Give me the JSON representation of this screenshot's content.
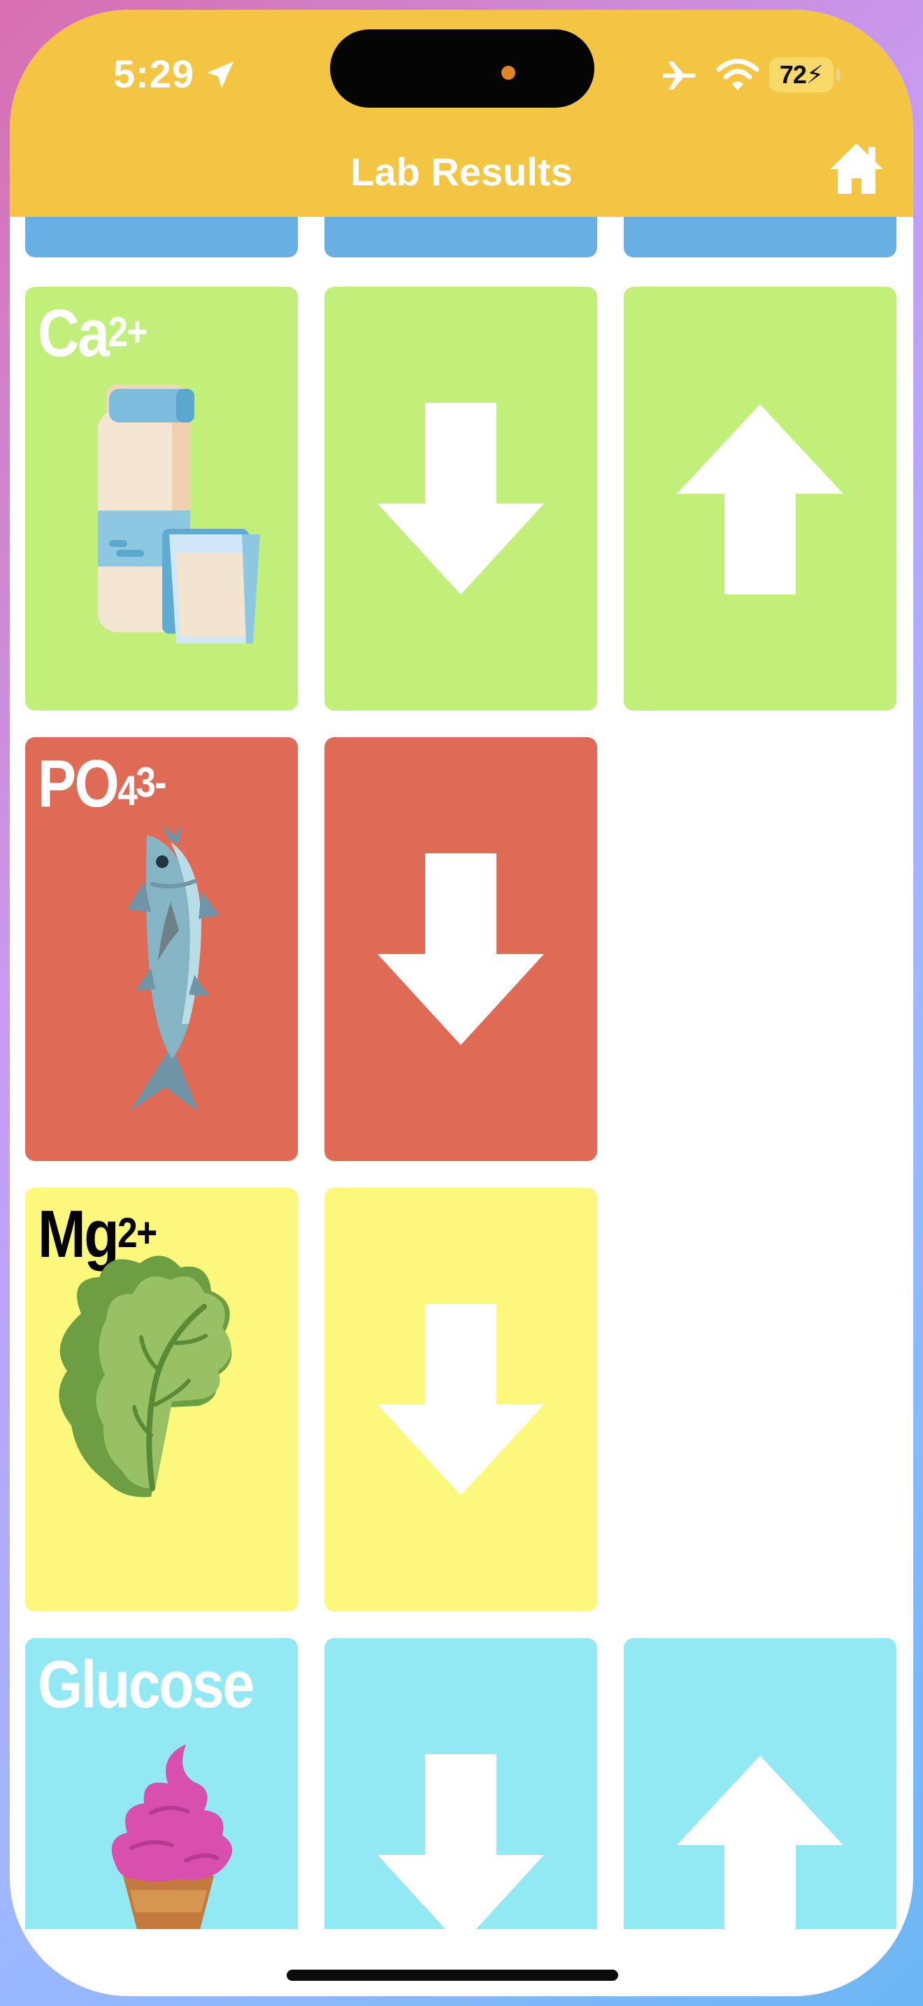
{
  "status_bar": {
    "time": "5:29",
    "battery": "72",
    "icons": [
      "location-arrow-icon",
      "airplane-icon",
      "wifi-icon",
      "battery-charging-icon"
    ]
  },
  "header": {
    "title": "Lab Results",
    "home_icon": "home-icon"
  },
  "colors": {
    "header": "#f3c542",
    "partial_row": "#68afe3",
    "calcium": "#c0f07a",
    "phosphate": "#df6a55",
    "magnesium": "#fbf87b",
    "glucose": "#92e8f3",
    "arrow": "#ffffff"
  },
  "rows": [
    {
      "id": "partial",
      "tiles": [
        "tile",
        "tile",
        "tile"
      ]
    },
    {
      "id": "calcium",
      "label_main": "Ca",
      "label_sup": "2+",
      "label_color": "#ffffff",
      "food_icon": "milk-bottle-and-glass-icon",
      "arrows": [
        "low-arrow-down-icon",
        "high-arrow-up-icon"
      ]
    },
    {
      "id": "phosphate",
      "label_main": "PO",
      "label_sub": "4",
      "label_sup": "3-",
      "label_color": "#ffffff",
      "food_icon": "tuna-fish-icon",
      "arrows": [
        "low-arrow-down-icon"
      ]
    },
    {
      "id": "magnesium",
      "label_main": "Mg",
      "label_sup": "2+",
      "label_color": "#000000",
      "food_icon": "lettuce-leaf-icon",
      "arrows": [
        "low-arrow-down-icon"
      ]
    },
    {
      "id": "glucose",
      "label_main": "Glucose",
      "label_color": "#ffffff",
      "food_icon": "ice-cream-cone-icon",
      "arrows": [
        "low-arrow-down-icon",
        "high-arrow-up-icon"
      ]
    }
  ]
}
